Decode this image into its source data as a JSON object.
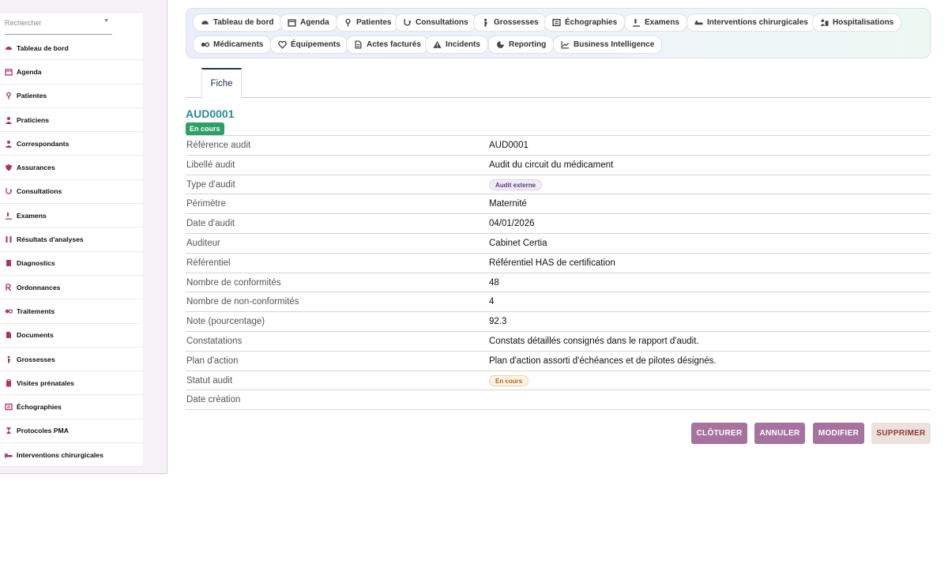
{
  "sidebar": {
    "search_placeholder": "Rechercher",
    "items": [
      {
        "label": "Tableau de bord",
        "icon": "gauge-icon"
      },
      {
        "label": "Agenda",
        "icon": "calendar-icon"
      },
      {
        "label": "Patientes",
        "icon": "female-icon"
      },
      {
        "label": "Praticiens",
        "icon": "user-md-icon"
      },
      {
        "label": "Correspondants",
        "icon": "user-icon"
      },
      {
        "label": "Assurances",
        "icon": "shield-icon"
      },
      {
        "label": "Consultations",
        "icon": "stethoscope-icon"
      },
      {
        "label": "Examens",
        "icon": "microscope-icon"
      },
      {
        "label": "Résultats d'analyses",
        "icon": "vials-icon"
      },
      {
        "label": "Diagnostics",
        "icon": "file-medical-icon"
      },
      {
        "label": "Ordonnances",
        "icon": "prescription-icon"
      },
      {
        "label": "Traitements",
        "icon": "pills-icon"
      },
      {
        "label": "Documents",
        "icon": "document-icon"
      },
      {
        "label": "Grossesses",
        "icon": "pregnant-icon"
      },
      {
        "label": "Visites prénatales",
        "icon": "clipboard-icon"
      },
      {
        "label": "Échographies",
        "icon": "ultrasound-icon"
      },
      {
        "label": "Protocoles PMA",
        "icon": "hourglass-icon"
      },
      {
        "label": "Interventions chirurgicales",
        "icon": "bed-icon"
      }
    ]
  },
  "topnav": {
    "items": [
      {
        "label": "Tableau de bord",
        "icon": "gauge-icon"
      },
      {
        "label": "Agenda",
        "icon": "calendar-icon"
      },
      {
        "label": "Patientes",
        "icon": "female-icon"
      },
      {
        "label": "Consultations",
        "icon": "stethoscope-icon"
      },
      {
        "label": "Grossesses",
        "icon": "pregnant-icon"
      },
      {
        "label": "Échographies",
        "icon": "ultrasound-icon"
      },
      {
        "label": "Examens",
        "icon": "microscope-icon"
      },
      {
        "label": "Interventions chirurgicales",
        "icon": "bed-icon"
      },
      {
        "label": "Hospitalisations",
        "icon": "hospital-user-icon"
      },
      {
        "label": "Médicaments",
        "icon": "pills-icon"
      },
      {
        "label": "Équipements",
        "icon": "heart-pulse-icon"
      },
      {
        "label": "Actes facturés",
        "icon": "invoice-icon"
      },
      {
        "label": "Incidents",
        "icon": "warning-icon"
      },
      {
        "label": "Reporting",
        "icon": "pie-chart-icon"
      },
      {
        "label": "Business Intelligence",
        "icon": "line-chart-icon"
      }
    ]
  },
  "tabs": {
    "fiche": "Fiche"
  },
  "record": {
    "id": "AUD0001",
    "status_badge": "En cours",
    "fields": [
      {
        "label": "Référence audit",
        "value": "AUD0001"
      },
      {
        "label": "Libellé audit",
        "value": "Audit du circuit du médicament"
      },
      {
        "label": "Type d'audit",
        "value": "Audit externe"
      },
      {
        "label": "Périmètre",
        "value": "Maternité"
      },
      {
        "label": "Date d'audit",
        "value": "04/01/2026"
      },
      {
        "label": "Auditeur",
        "value": "Cabinet Certia"
      },
      {
        "label": "Référentiel",
        "value": "Référentiel HAS de certification"
      },
      {
        "label": "Nombre de conformités",
        "value": "48"
      },
      {
        "label": "Nombre de non-conformités",
        "value": "4"
      },
      {
        "label": "Note (pourcentage)",
        "value": "92.3"
      },
      {
        "label": "Constatations",
        "value": "Constats détaillés consignés dans le rapport d'audit."
      },
      {
        "label": "Plan d'action",
        "value": "Plan d'action assorti d'échéances et de pilotes désignés."
      },
      {
        "label": "Statut audit",
        "value": "En cours"
      },
      {
        "label": "Date création",
        "value": ""
      }
    ]
  },
  "actions": {
    "cloturer": "CLÔTURER",
    "annuler": "ANNULER",
    "modifier": "MODIFIER",
    "supprimer": "SUPPRIMER"
  },
  "colors": {
    "accent_purple": "#a6739f",
    "status_green": "#2aa169",
    "record_teal": "#2a8a97",
    "sidebar_icon": "#b0306a"
  }
}
